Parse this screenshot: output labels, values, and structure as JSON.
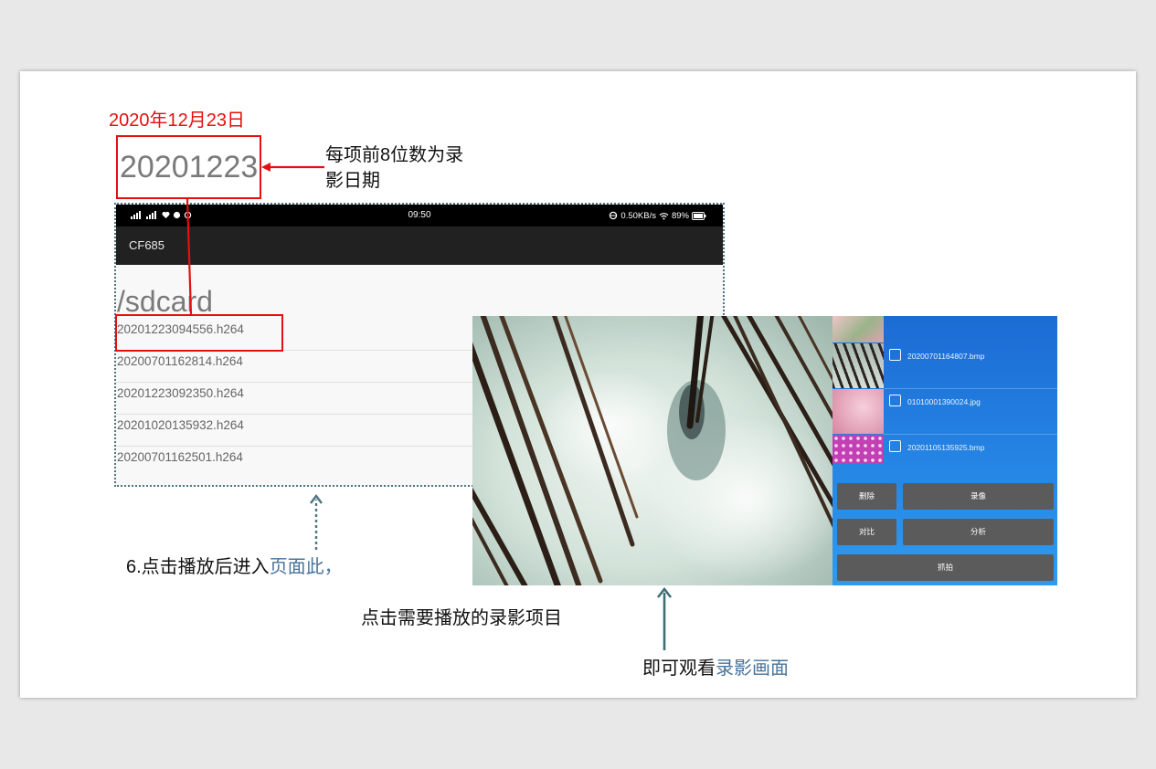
{
  "annotations": {
    "date_label": "2020年12月23日",
    "date_code": "20201223",
    "explanation_line1": "每项前8位数为录",
    "explanation_line2": "影日期",
    "caption_step6_prefix": "6.点击播放后进入",
    "caption_step6_highlight": "页面此，",
    "caption_select": "点击需要播放的录影项目",
    "caption_view_prefix": "即可观看",
    "caption_view_highlight": "录影画面",
    "colors": {
      "highlight_red": "#e41010",
      "caption_accent": "#48739a",
      "arrow_teal": "#3f6f73"
    }
  },
  "phone": {
    "status_bar": {
      "time": "09:50",
      "network_speed": "0.50KB/s",
      "battery": "89%",
      "icons": [
        "signal-4g-icon",
        "signal-4g-icon",
        "vpn-heart-icon",
        "chat-icon",
        "sync-icon",
        "data-saver-icon",
        "wifi-icon",
        "battery-icon"
      ]
    },
    "app_title": "CF685",
    "folder_path": "/sdcard",
    "files": [
      "20201223094556.h264",
      "20200701162814.h264",
      "20201223092350.h264",
      "20201020135932.h264",
      "20200701162501.h264"
    ]
  },
  "viewer": {
    "media_list": [
      {
        "name": "20200701164807.bmp",
        "thumbnail": "hair-sample-thumbnail"
      },
      {
        "name": "01010001390024.jpg",
        "thumbnail": "pink-skin-thumbnail"
      },
      {
        "name": "20201105135925.bmp",
        "thumbnail": "magenta-dots-thumbnail"
      }
    ],
    "buttons": {
      "delete": "删除",
      "record": "录像",
      "compare": "对比",
      "analyze": "分析",
      "capture": "抓拍"
    }
  }
}
